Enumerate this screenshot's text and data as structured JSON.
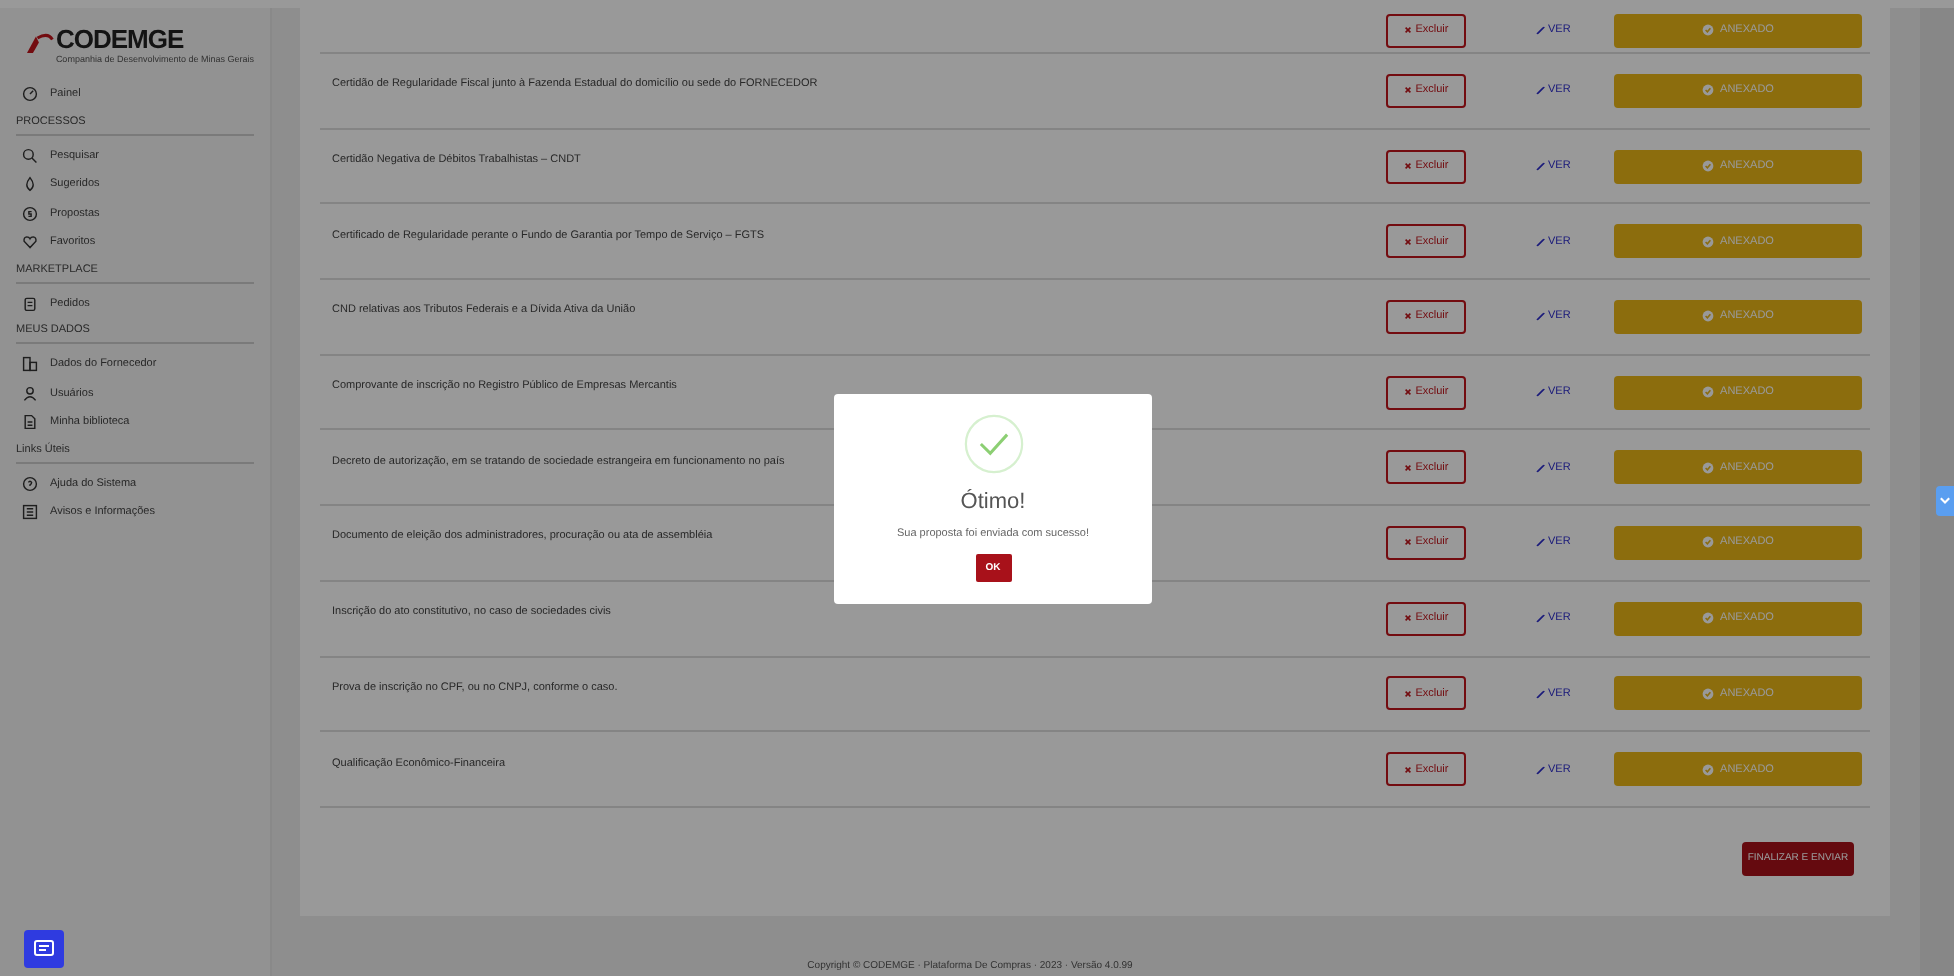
{
  "sidebar": {
    "logo": "CODEMGE",
    "logo_subtitle": "Companhia de Desenvolvimento de Minas Gerais",
    "sections": [
      {
        "items": [
          {
            "label": "Painel"
          }
        ]
      },
      {
        "title": "PROCESSOS",
        "items": [
          {
            "label": "Pesquisar"
          },
          {
            "label": "Sugeridos"
          },
          {
            "label": "Propostas"
          },
          {
            "label": "Favoritos"
          }
        ]
      },
      {
        "title": "MARKETPLACE",
        "items": [
          {
            "label": "Pedidos"
          }
        ]
      },
      {
        "title": "MEUS DADOS",
        "items": [
          {
            "label": "Dados do Fornecedor"
          },
          {
            "label": "Usuários"
          },
          {
            "label": "Minha biblioteca"
          }
        ]
      },
      {
        "title": "Links Úteis",
        "items": [
          {
            "label": "Ajuda do Sistema"
          },
          {
            "label": "Avisos e Informações"
          }
        ]
      }
    ]
  },
  "documents": [
    {
      "delete": "Excluir",
      "view": "VER",
      "status": "ANEXADO"
    },
    {
      "name": "Certidão de Regularidade Fiscal junto à Fazenda Estadual do domicílio ou sede do FORNECEDOR",
      "delete": "Excluir",
      "view": "VER",
      "status": "ANEXADO"
    },
    {
      "name": "Certidão Negativa de Débitos Trabalhistas – CNDT",
      "delete": "Excluir",
      "view": "VER",
      "status": "ANEXADO"
    },
    {
      "name": "Certificado de Regularidade perante o Fundo de Garantia por Tempo de Serviço – FGTS",
      "delete": "Excluir",
      "view": "VER",
      "status": "ANEXADO"
    },
    {
      "name": "CND relativas aos Tributos Federais e a Dívida Ativa da União",
      "delete": "Excluir",
      "view": "VER",
      "status": "ANEXADO"
    },
    {
      "name": "Comprovante de inscrição no Registro Público de Empresas Mercantis",
      "delete": "Excluir",
      "view": "VER",
      "status": "ANEXADO"
    },
    {
      "name": "Decreto de autorização, em se tratando de sociedade estrangeira em funcionamento no país",
      "delete": "Excluir",
      "view": "VER",
      "status": "ANEXADO"
    },
    {
      "name": "Documento de eleição dos administradores, procuração ou ata de assembléia",
      "delete": "Excluir",
      "view": "VER",
      "status": "ANEXADO"
    },
    {
      "name": "Inscrição do ato constitutivo, no caso de sociedades civis",
      "delete": "Excluir",
      "view": "VER",
      "status": "ANEXADO"
    },
    {
      "name": "Prova de inscrição no CPF, ou no CNPJ, conforme o caso.",
      "delete": "Excluir",
      "view": "VER",
      "status": "ANEXADO"
    },
    {
      "name": "Qualificação Econômico-Financeira",
      "delete": "Excluir",
      "view": "VER",
      "status": "ANEXADO"
    }
  ],
  "submit_button": "FINALIZAR E ENVIAR",
  "footer": "Copyright © CODEMGE · Plataforma De Compras · 2023 · Versão 4.0.99",
  "modal": {
    "title": "Ótimo!",
    "message": "Sua proposta foi enviada com sucesso!",
    "button": "OK"
  }
}
